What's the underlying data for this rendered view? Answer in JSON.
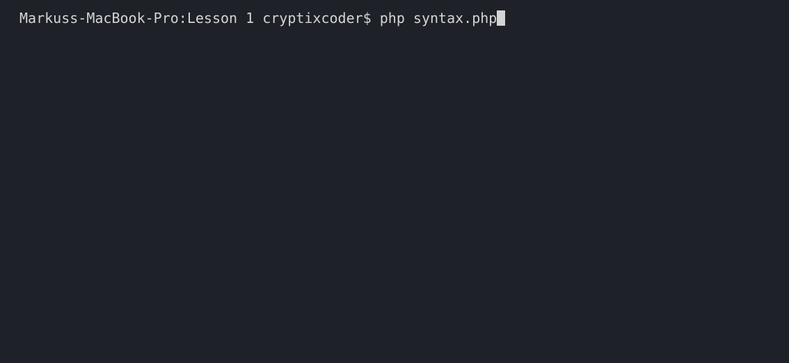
{
  "terminal": {
    "prompt": "Markuss-MacBook-Pro:Lesson 1 cryptixcoder$ ",
    "command": "php syntax.php"
  }
}
